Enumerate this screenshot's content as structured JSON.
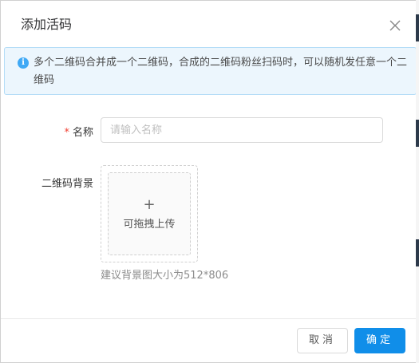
{
  "dialog": {
    "title": "添加活码",
    "close_icon": "close-icon"
  },
  "alert": {
    "icon": "info-icon",
    "icon_glyph": "i",
    "text": "多个二维码合并成一个二维码，合成的二维码粉丝扫码时，可以随机发任意一个二维码"
  },
  "form": {
    "name": {
      "required_mark": "*",
      "label": "名称",
      "placeholder": "请输入名称",
      "value": ""
    },
    "background": {
      "label": "二维码背景",
      "upload_icon": "plus-icon",
      "upload_glyph": "+",
      "upload_text": "可拖拽上传",
      "hint": "建议背景图大小为512*806"
    }
  },
  "footer": {
    "cancel_label": "取消",
    "ok_label": "确定"
  },
  "colors": {
    "primary": "#108ee9",
    "alert_bg": "#ecf6fd",
    "alert_border": "#b3dcf7",
    "required": "#f04134"
  }
}
